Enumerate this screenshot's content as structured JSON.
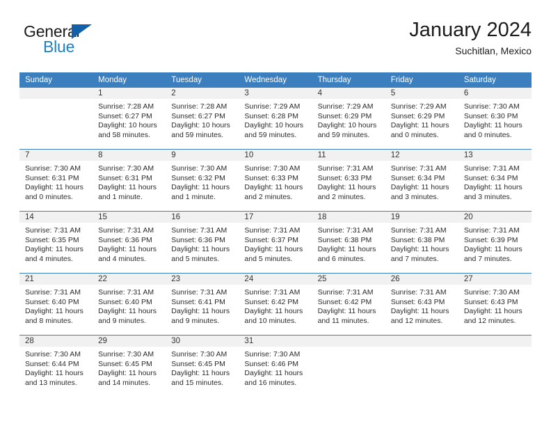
{
  "brand": {
    "name_top": "General",
    "name_bottom": "Blue"
  },
  "header": {
    "title": "January 2024",
    "subtitle": "Suchitlan, Mexico"
  },
  "colors": {
    "header_blue": "#3c7fbf",
    "logo_blue": "#1f7fc4",
    "triangle_blue": "#1260a8",
    "daynum_band": "#f1f1f1"
  },
  "weekdays": [
    "Sunday",
    "Monday",
    "Tuesday",
    "Wednesday",
    "Thursday",
    "Friday",
    "Saturday"
  ],
  "labels": {
    "sunrise_prefix": "Sunrise:",
    "sunset_prefix": "Sunset:",
    "daylight_prefix": "Daylight:"
  },
  "weeks": [
    [
      {
        "day": "",
        "sunrise": "",
        "sunset": "",
        "daylight_1": "",
        "daylight_2": ""
      },
      {
        "day": "1",
        "sunrise": "Sunrise: 7:28 AM",
        "sunset": "Sunset: 6:27 PM",
        "daylight_1": "Daylight: 10 hours",
        "daylight_2": "and 58 minutes."
      },
      {
        "day": "2",
        "sunrise": "Sunrise: 7:28 AM",
        "sunset": "Sunset: 6:27 PM",
        "daylight_1": "Daylight: 10 hours",
        "daylight_2": "and 59 minutes."
      },
      {
        "day": "3",
        "sunrise": "Sunrise: 7:29 AM",
        "sunset": "Sunset: 6:28 PM",
        "daylight_1": "Daylight: 10 hours",
        "daylight_2": "and 59 minutes."
      },
      {
        "day": "4",
        "sunrise": "Sunrise: 7:29 AM",
        "sunset": "Sunset: 6:29 PM",
        "daylight_1": "Daylight: 10 hours",
        "daylight_2": "and 59 minutes."
      },
      {
        "day": "5",
        "sunrise": "Sunrise: 7:29 AM",
        "sunset": "Sunset: 6:29 PM",
        "daylight_1": "Daylight: 11 hours",
        "daylight_2": "and 0 minutes."
      },
      {
        "day": "6",
        "sunrise": "Sunrise: 7:30 AM",
        "sunset": "Sunset: 6:30 PM",
        "daylight_1": "Daylight: 11 hours",
        "daylight_2": "and 0 minutes."
      }
    ],
    [
      {
        "day": "7",
        "sunrise": "Sunrise: 7:30 AM",
        "sunset": "Sunset: 6:31 PM",
        "daylight_1": "Daylight: 11 hours",
        "daylight_2": "and 0 minutes."
      },
      {
        "day": "8",
        "sunrise": "Sunrise: 7:30 AM",
        "sunset": "Sunset: 6:31 PM",
        "daylight_1": "Daylight: 11 hours",
        "daylight_2": "and 1 minute."
      },
      {
        "day": "9",
        "sunrise": "Sunrise: 7:30 AM",
        "sunset": "Sunset: 6:32 PM",
        "daylight_1": "Daylight: 11 hours",
        "daylight_2": "and 1 minute."
      },
      {
        "day": "10",
        "sunrise": "Sunrise: 7:30 AM",
        "sunset": "Sunset: 6:33 PM",
        "daylight_1": "Daylight: 11 hours",
        "daylight_2": "and 2 minutes."
      },
      {
        "day": "11",
        "sunrise": "Sunrise: 7:31 AM",
        "sunset": "Sunset: 6:33 PM",
        "daylight_1": "Daylight: 11 hours",
        "daylight_2": "and 2 minutes."
      },
      {
        "day": "12",
        "sunrise": "Sunrise: 7:31 AM",
        "sunset": "Sunset: 6:34 PM",
        "daylight_1": "Daylight: 11 hours",
        "daylight_2": "and 3 minutes."
      },
      {
        "day": "13",
        "sunrise": "Sunrise: 7:31 AM",
        "sunset": "Sunset: 6:34 PM",
        "daylight_1": "Daylight: 11 hours",
        "daylight_2": "and 3 minutes."
      }
    ],
    [
      {
        "day": "14",
        "sunrise": "Sunrise: 7:31 AM",
        "sunset": "Sunset: 6:35 PM",
        "daylight_1": "Daylight: 11 hours",
        "daylight_2": "and 4 minutes."
      },
      {
        "day": "15",
        "sunrise": "Sunrise: 7:31 AM",
        "sunset": "Sunset: 6:36 PM",
        "daylight_1": "Daylight: 11 hours",
        "daylight_2": "and 4 minutes."
      },
      {
        "day": "16",
        "sunrise": "Sunrise: 7:31 AM",
        "sunset": "Sunset: 6:36 PM",
        "daylight_1": "Daylight: 11 hours",
        "daylight_2": "and 5 minutes."
      },
      {
        "day": "17",
        "sunrise": "Sunrise: 7:31 AM",
        "sunset": "Sunset: 6:37 PM",
        "daylight_1": "Daylight: 11 hours",
        "daylight_2": "and 5 minutes."
      },
      {
        "day": "18",
        "sunrise": "Sunrise: 7:31 AM",
        "sunset": "Sunset: 6:38 PM",
        "daylight_1": "Daylight: 11 hours",
        "daylight_2": "and 6 minutes."
      },
      {
        "day": "19",
        "sunrise": "Sunrise: 7:31 AM",
        "sunset": "Sunset: 6:38 PM",
        "daylight_1": "Daylight: 11 hours",
        "daylight_2": "and 7 minutes."
      },
      {
        "day": "20",
        "sunrise": "Sunrise: 7:31 AM",
        "sunset": "Sunset: 6:39 PM",
        "daylight_1": "Daylight: 11 hours",
        "daylight_2": "and 7 minutes."
      }
    ],
    [
      {
        "day": "21",
        "sunrise": "Sunrise: 7:31 AM",
        "sunset": "Sunset: 6:40 PM",
        "daylight_1": "Daylight: 11 hours",
        "daylight_2": "and 8 minutes."
      },
      {
        "day": "22",
        "sunrise": "Sunrise: 7:31 AM",
        "sunset": "Sunset: 6:40 PM",
        "daylight_1": "Daylight: 11 hours",
        "daylight_2": "and 9 minutes."
      },
      {
        "day": "23",
        "sunrise": "Sunrise: 7:31 AM",
        "sunset": "Sunset: 6:41 PM",
        "daylight_1": "Daylight: 11 hours",
        "daylight_2": "and 9 minutes."
      },
      {
        "day": "24",
        "sunrise": "Sunrise: 7:31 AM",
        "sunset": "Sunset: 6:42 PM",
        "daylight_1": "Daylight: 11 hours",
        "daylight_2": "and 10 minutes."
      },
      {
        "day": "25",
        "sunrise": "Sunrise: 7:31 AM",
        "sunset": "Sunset: 6:42 PM",
        "daylight_1": "Daylight: 11 hours",
        "daylight_2": "and 11 minutes."
      },
      {
        "day": "26",
        "sunrise": "Sunrise: 7:31 AM",
        "sunset": "Sunset: 6:43 PM",
        "daylight_1": "Daylight: 11 hours",
        "daylight_2": "and 12 minutes."
      },
      {
        "day": "27",
        "sunrise": "Sunrise: 7:30 AM",
        "sunset": "Sunset: 6:43 PM",
        "daylight_1": "Daylight: 11 hours",
        "daylight_2": "and 12 minutes."
      }
    ],
    [
      {
        "day": "28",
        "sunrise": "Sunrise: 7:30 AM",
        "sunset": "Sunset: 6:44 PM",
        "daylight_1": "Daylight: 11 hours",
        "daylight_2": "and 13 minutes."
      },
      {
        "day": "29",
        "sunrise": "Sunrise: 7:30 AM",
        "sunset": "Sunset: 6:45 PM",
        "daylight_1": "Daylight: 11 hours",
        "daylight_2": "and 14 minutes."
      },
      {
        "day": "30",
        "sunrise": "Sunrise: 7:30 AM",
        "sunset": "Sunset: 6:45 PM",
        "daylight_1": "Daylight: 11 hours",
        "daylight_2": "and 15 minutes."
      },
      {
        "day": "31",
        "sunrise": "Sunrise: 7:30 AM",
        "sunset": "Sunset: 6:46 PM",
        "daylight_1": "Daylight: 11 hours",
        "daylight_2": "and 16 minutes."
      },
      {
        "day": "",
        "sunrise": "",
        "sunset": "",
        "daylight_1": "",
        "daylight_2": ""
      },
      {
        "day": "",
        "sunrise": "",
        "sunset": "",
        "daylight_1": "",
        "daylight_2": ""
      },
      {
        "day": "",
        "sunrise": "",
        "sunset": "",
        "daylight_1": "",
        "daylight_2": ""
      }
    ]
  ]
}
